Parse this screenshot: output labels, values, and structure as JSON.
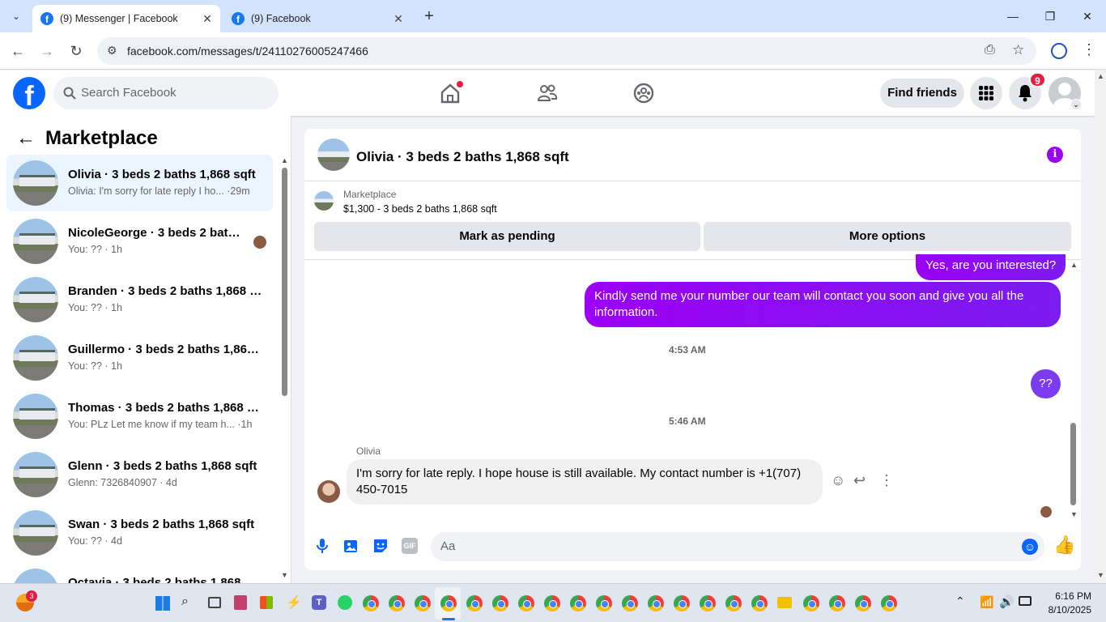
{
  "browser": {
    "tabs": [
      {
        "title": "(9) Messenger | Facebook",
        "active": true
      },
      {
        "title": "(9) Facebook",
        "active": false
      }
    ],
    "url": "facebook.com/messages/t/24110276005247466"
  },
  "fb_header": {
    "search_placeholder": "Search Facebook",
    "find_friends_label": "Find friends",
    "notification_count": "9"
  },
  "sidebar": {
    "title": "Marketplace",
    "conversations": [
      {
        "name": "Olivia · 3 beds 2 baths 1,868 sqft",
        "preview": "Olivia: I'm sorry for late reply I ho... ·29m",
        "selected": true
      },
      {
        "name": "NicoleGeorge · 3 beds 2 baths...",
        "preview": "You: ?? · 1h",
        "selected": false
      },
      {
        "name": "Branden · 3 beds 2 baths 1,868 s...",
        "preview": "You: ?? · 1h",
        "selected": false
      },
      {
        "name": "Guillermo · 3 beds 2 baths 1,868 ...",
        "preview": "You: ?? · 1h",
        "selected": false
      },
      {
        "name": "Thomas · 3 beds 2 baths 1,868 s...",
        "preview": "You: PLz Let me know if my team h... ·1h",
        "selected": false
      },
      {
        "name": "Glenn · 3 beds 2 baths 1,868 sqft",
        "preview": "Glenn: 7326840907 · 4d",
        "selected": false
      },
      {
        "name": "Swan · 3 beds 2 baths 1,868 sqft",
        "preview": "You: ?? · 4d",
        "selected": false
      },
      {
        "name": "Octavia · 3 beds 2 baths 1,868...",
        "preview": "",
        "selected": false
      }
    ]
  },
  "chat": {
    "title": "Olivia · 3 beds 2 baths 1,868 sqft",
    "marketplace_label": "Marketplace",
    "listing": "$1,300 - 3 beds 2 baths 1,868 sqft",
    "mark_pending_label": "Mark as pending",
    "more_options_label": "More options",
    "messages": {
      "out1": "Yes, are you interested?",
      "out2": "Kindly send me your number our team will contact you soon and give you all the information.",
      "time1": "4:53 AM",
      "out3": "??",
      "time2": "5:46 AM",
      "sender": "Olivia",
      "in1": "I'm sorry for late reply. I hope house is still available. My contact number is +1(707) 450-7015"
    },
    "composer_placeholder": "Aa"
  },
  "taskbar": {
    "time": "6:16 PM",
    "date": "8/10/2025",
    "weather_badge": "3"
  },
  "colors": {
    "fb_blue": "#0866ff",
    "bubble_purple": "#8a00ff",
    "notif_red": "#e41e3f"
  }
}
